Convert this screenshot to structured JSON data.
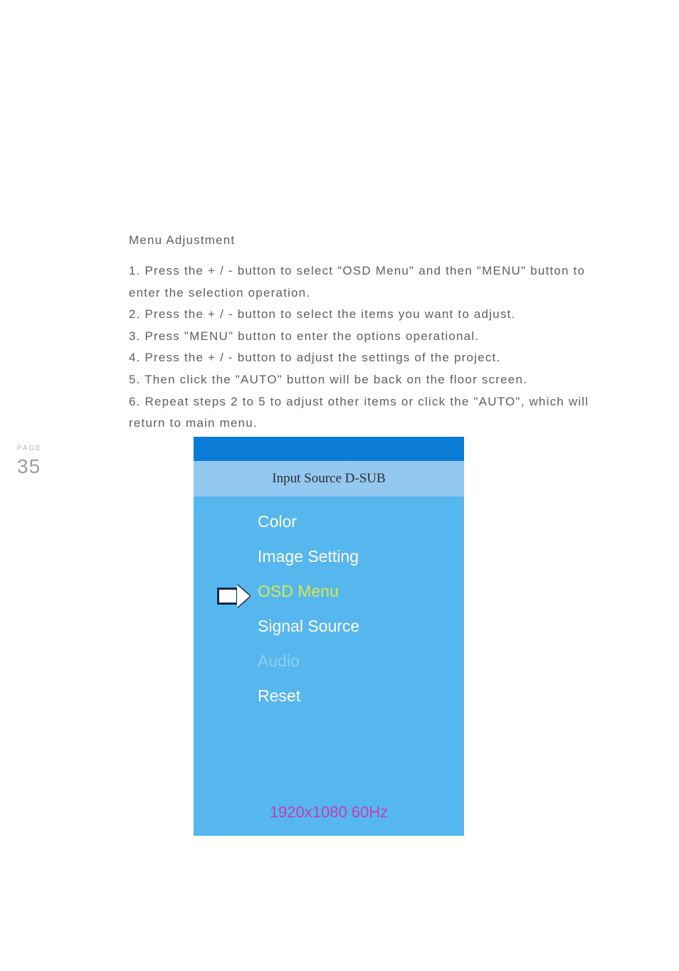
{
  "page_label": "PAGE",
  "page_number": "35",
  "heading": "Menu Adjustment",
  "instructions": [
    "1. Press the + / - button to select \"OSD Menu\" and then \"MENU\" button to enter the selection operation.",
    "2. Press the + / - button to select the items you want to adjust.",
    "3. Press \"MENU\" button to enter the options operational.",
    "4. Press the + / - button to adjust the settings of the project.",
    "5. Then click the \"AUTO\" button will be back on the floor screen.",
    "6. Repeat steps 2 to 5 to adjust other items or click the \"AUTO\", which will return to main menu."
  ],
  "osd": {
    "title": "Input Source D-SUB",
    "items": [
      {
        "label": "Color",
        "state": "normal"
      },
      {
        "label": "Image Setting",
        "state": "normal"
      },
      {
        "label": "OSD Menu",
        "state": "highlight"
      },
      {
        "label": "Signal Source",
        "state": "normal"
      },
      {
        "label": "Audio",
        "state": "dim"
      },
      {
        "label": "Reset",
        "state": "normal"
      }
    ],
    "resolution": "1920x1080 60Hz"
  }
}
